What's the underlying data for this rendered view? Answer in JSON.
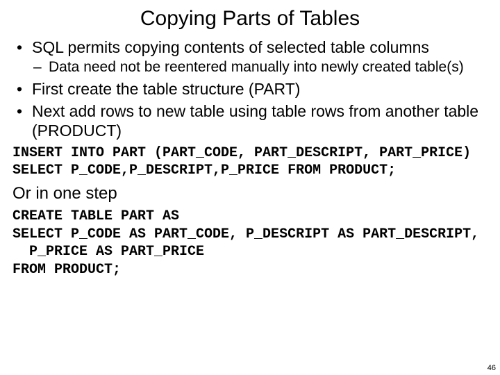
{
  "title": "Copying Parts of Tables",
  "bullets": {
    "b1": "SQL permits copying contents of selected table columns",
    "b1_sub1": "Data need not be reentered manually into newly created table(s)",
    "b2": "First create the table structure (PART)",
    "b3": "Next add rows to new table using table rows from another table (PRODUCT)"
  },
  "code1": "INSERT INTO PART (PART_CODE, PART_DESCRIPT, PART_PRICE)\nSELECT P_CODE,P_DESCRIPT,P_PRICE FROM PRODUCT;",
  "or_line": "Or in one step",
  "code2": "CREATE TABLE PART AS\nSELECT P_CODE AS PART_CODE, P_DESCRIPT AS PART_DESCRIPT,\n  P_PRICE AS PART_PRICE\nFROM PRODUCT;",
  "page_number": "46"
}
